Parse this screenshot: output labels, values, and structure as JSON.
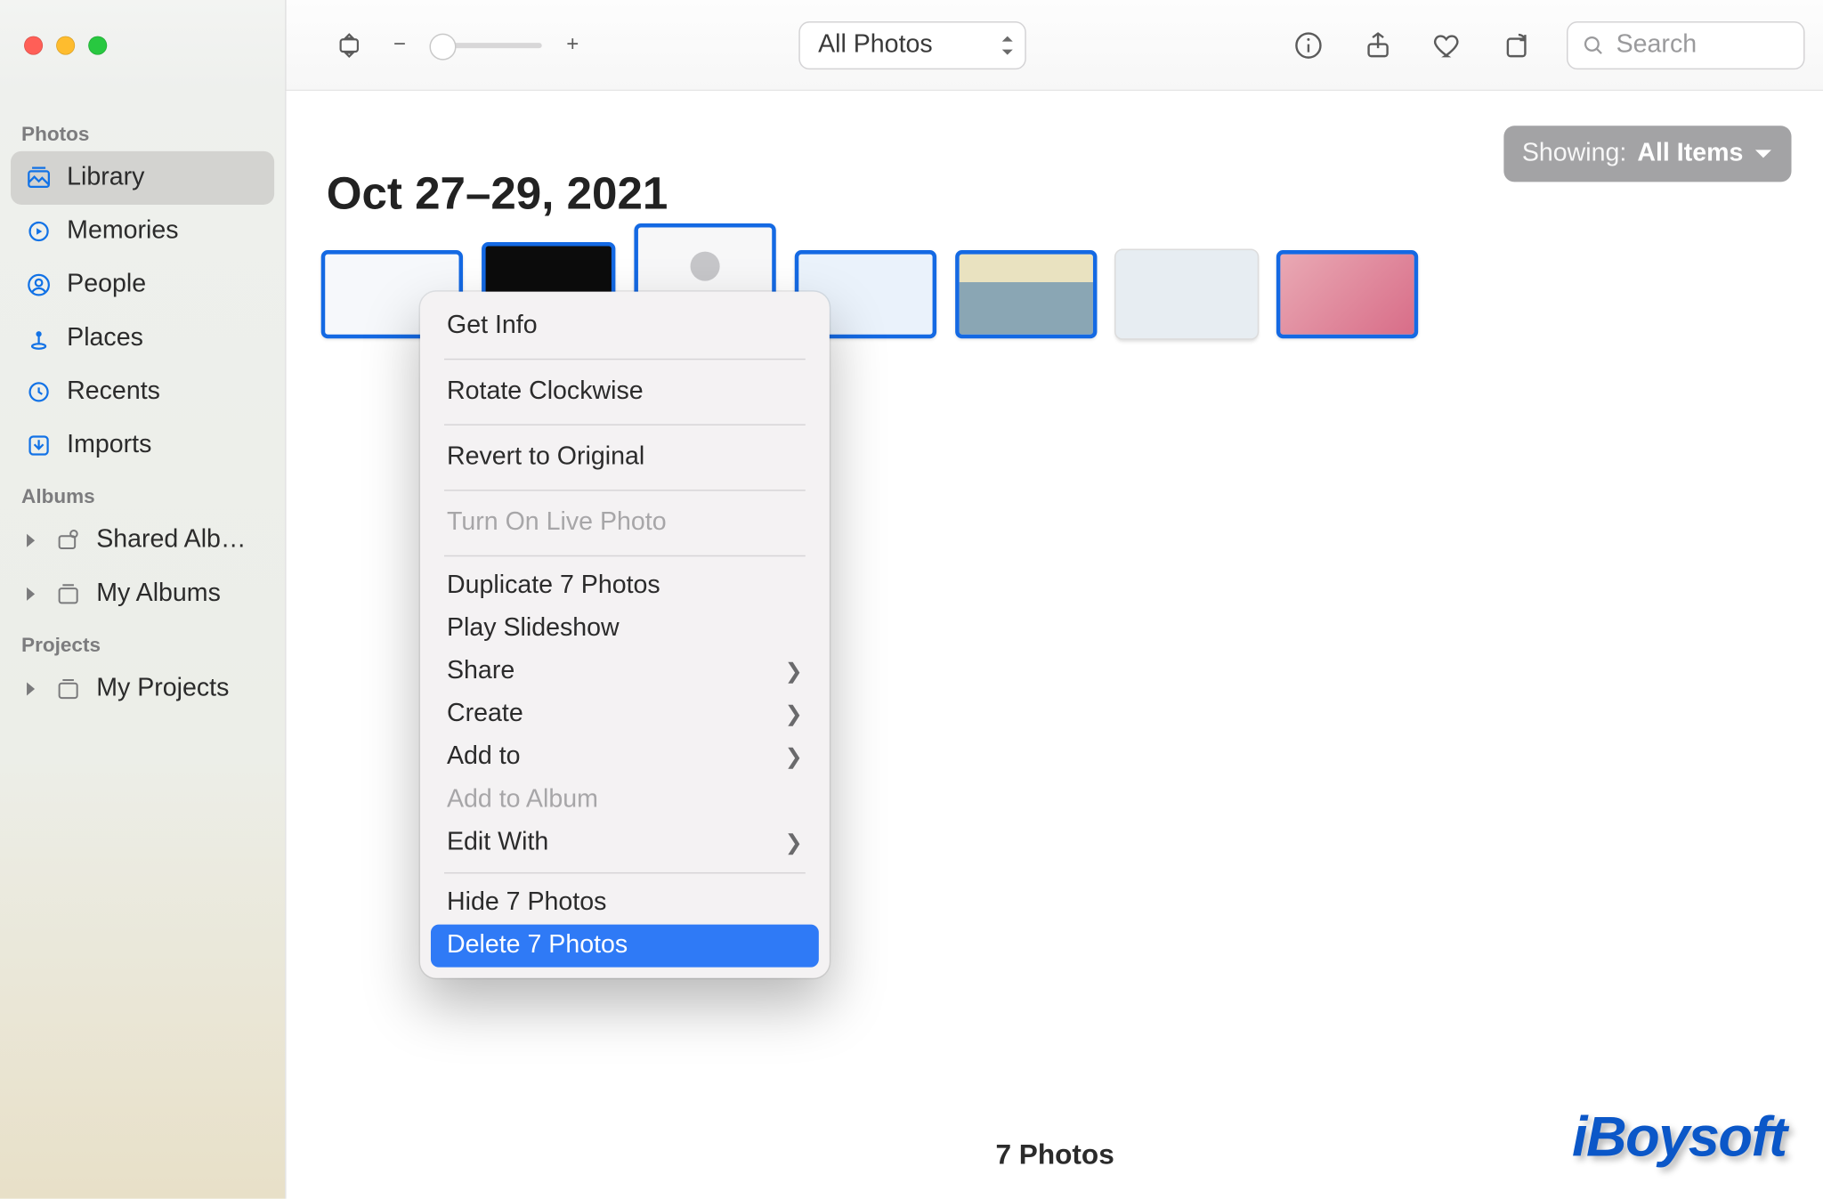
{
  "toolbar": {
    "view_selector": "All Photos",
    "search_placeholder": "Search",
    "zoom_minus": "−",
    "zoom_plus": "+"
  },
  "sidebar": {
    "sections": {
      "photos": "Photos",
      "albums": "Albums",
      "projects": "Projects"
    },
    "items": {
      "library": "Library",
      "memories": "Memories",
      "people": "People",
      "places": "Places",
      "recents": "Recents",
      "imports": "Imports",
      "shared_albums": "Shared Alb…",
      "my_albums": "My Albums",
      "my_projects": "My Projects"
    }
  },
  "content": {
    "date_header": "Oct 27–29, 2021",
    "filter_prefix": "Showing:",
    "filter_value": "All Items",
    "footer_count": "7 Photos"
  },
  "context_menu": {
    "get_info": "Get Info",
    "rotate_cw": "Rotate Clockwise",
    "revert": "Revert to Original",
    "live_photo": "Turn On Live Photo",
    "duplicate": "Duplicate 7 Photos",
    "slideshow": "Play Slideshow",
    "share": "Share",
    "create": "Create",
    "add_to": "Add to",
    "add_to_album": "Add to Album",
    "edit_with": "Edit With",
    "hide": "Hide 7 Photos",
    "delete": "Delete 7 Photos"
  },
  "watermark": "iBoysoft"
}
